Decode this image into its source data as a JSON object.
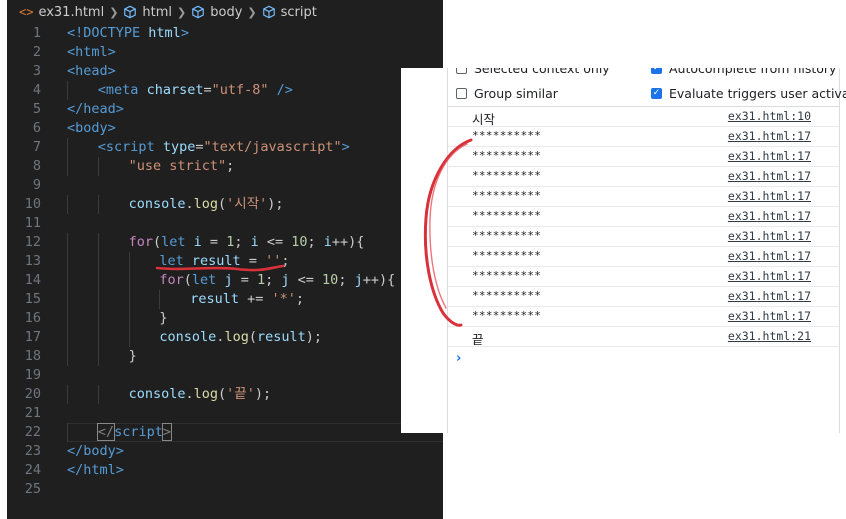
{
  "breadcrumb": {
    "file": "ex31.html",
    "crumbs": [
      "html",
      "body",
      "script"
    ]
  },
  "editor": {
    "lines": [
      {
        "n": "1",
        "indent": 0,
        "tokens": [
          [
            "tag",
            "<!DOCTYPE"
          ],
          [
            "txt",
            " "
          ],
          [
            "attr",
            "html"
          ],
          [
            "tag",
            ">"
          ]
        ]
      },
      {
        "n": "2",
        "indent": 0,
        "tokens": [
          [
            "tag",
            "<html>"
          ]
        ]
      },
      {
        "n": "3",
        "indent": 0,
        "tokens": [
          [
            "tag",
            "<head>"
          ]
        ]
      },
      {
        "n": "4",
        "indent": 1,
        "tokens": [
          [
            "tag",
            "<meta"
          ],
          [
            "txt",
            " "
          ],
          [
            "attr",
            "charset"
          ],
          [
            "txt",
            "="
          ],
          [
            "str",
            "\"utf-8\""
          ],
          [
            "txt",
            " "
          ],
          [
            "tag",
            "/>"
          ]
        ]
      },
      {
        "n": "5",
        "indent": 0,
        "tokens": [
          [
            "tag",
            "</head>"
          ]
        ]
      },
      {
        "n": "6",
        "indent": 0,
        "tokens": [
          [
            "tag",
            "<body>"
          ]
        ]
      },
      {
        "n": "7",
        "indent": 1,
        "tokens": [
          [
            "tag",
            "<script"
          ],
          [
            "txt",
            " "
          ],
          [
            "attr",
            "type"
          ],
          [
            "txt",
            "="
          ],
          [
            "str",
            "\"text/javascript\""
          ],
          [
            "tag",
            ">"
          ]
        ]
      },
      {
        "n": "8",
        "indent": 2,
        "tokens": [
          [
            "str",
            "\"use strict\""
          ],
          [
            "txt",
            ";"
          ]
        ]
      },
      {
        "n": "9",
        "indent": 0,
        "tokens": []
      },
      {
        "n": "10",
        "indent": 2,
        "tokens": [
          [
            "var",
            "console"
          ],
          [
            "txt",
            "."
          ],
          [
            "fn",
            "log"
          ],
          [
            "txt",
            "("
          ],
          [
            "str",
            "'시작'"
          ],
          [
            "txt",
            ");"
          ]
        ]
      },
      {
        "n": "11",
        "indent": 0,
        "tokens": []
      },
      {
        "n": "12",
        "indent": 2,
        "tokens": [
          [
            "ctl",
            "for"
          ],
          [
            "txt",
            "("
          ],
          [
            "kw",
            "let"
          ],
          [
            "txt",
            " "
          ],
          [
            "var",
            "i"
          ],
          [
            "txt",
            " = "
          ],
          [
            "num",
            "1"
          ],
          [
            "txt",
            "; "
          ],
          [
            "var",
            "i"
          ],
          [
            "txt",
            " <= "
          ],
          [
            "num",
            "10"
          ],
          [
            "txt",
            "; "
          ],
          [
            "var",
            "i"
          ],
          [
            "txt",
            "++){"
          ]
        ]
      },
      {
        "n": "13",
        "indent": 3,
        "tokens": [
          [
            "kw",
            "let"
          ],
          [
            "txt",
            " "
          ],
          [
            "var",
            "result"
          ],
          [
            "txt",
            " = "
          ],
          [
            "str",
            "''"
          ],
          [
            "txt",
            ";"
          ]
        ]
      },
      {
        "n": "14",
        "indent": 3,
        "tokens": [
          [
            "ctl",
            "for"
          ],
          [
            "txt",
            "("
          ],
          [
            "kw",
            "let"
          ],
          [
            "txt",
            " "
          ],
          [
            "var",
            "j"
          ],
          [
            "txt",
            " = "
          ],
          [
            "num",
            "1"
          ],
          [
            "txt",
            "; "
          ],
          [
            "var",
            "j"
          ],
          [
            "txt",
            " <= "
          ],
          [
            "num",
            "10"
          ],
          [
            "txt",
            "; "
          ],
          [
            "var",
            "j"
          ],
          [
            "txt",
            "++){"
          ]
        ]
      },
      {
        "n": "15",
        "indent": 4,
        "tokens": [
          [
            "var",
            "result"
          ],
          [
            "txt",
            " += "
          ],
          [
            "str",
            "'*'"
          ],
          [
            "txt",
            ";"
          ]
        ]
      },
      {
        "n": "16",
        "indent": 3,
        "tokens": [
          [
            "txt",
            "}"
          ]
        ]
      },
      {
        "n": "17",
        "indent": 3,
        "tokens": [
          [
            "var",
            "console"
          ],
          [
            "txt",
            "."
          ],
          [
            "fn",
            "log"
          ],
          [
            "txt",
            "("
          ],
          [
            "var",
            "result"
          ],
          [
            "txt",
            ");"
          ]
        ]
      },
      {
        "n": "18",
        "indent": 2,
        "tokens": [
          [
            "txt",
            "}"
          ]
        ]
      },
      {
        "n": "19",
        "indent": 0,
        "tokens": []
      },
      {
        "n": "20",
        "indent": 2,
        "tokens": [
          [
            "var",
            "console"
          ],
          [
            "txt",
            "."
          ],
          [
            "fn",
            "log"
          ],
          [
            "txt",
            "("
          ],
          [
            "str",
            "'끝'"
          ],
          [
            "txt",
            ");"
          ]
        ]
      },
      {
        "n": "21",
        "indent": 0,
        "tokens": []
      },
      {
        "n": "22",
        "indent": 1,
        "tokens": [
          [
            "pun",
            "</"
          ],
          [
            "tag",
            "script"
          ],
          [
            "pun",
            ">"
          ]
        ]
      },
      {
        "n": "23",
        "indent": 0,
        "tokens": [
          [
            "tag",
            "</body>"
          ]
        ]
      },
      {
        "n": "24",
        "indent": 0,
        "tokens": [
          [
            "tag",
            "</html>"
          ]
        ]
      },
      {
        "n": "25",
        "indent": 0,
        "tokens": []
      }
    ]
  },
  "console": {
    "settings": {
      "selected_context": "Selected context only",
      "autocomplete": "Autocomplete from history",
      "group_similar": "Group similar",
      "evaluate_triggers": "Evaluate triggers user activation"
    },
    "messages": [
      {
        "text": "시작",
        "source": "ex31.html:10"
      },
      {
        "text": "**********",
        "source": "ex31.html:17"
      },
      {
        "text": "**********",
        "source": "ex31.html:17"
      },
      {
        "text": "**********",
        "source": "ex31.html:17"
      },
      {
        "text": "**********",
        "source": "ex31.html:17"
      },
      {
        "text": "**********",
        "source": "ex31.html:17"
      },
      {
        "text": "**********",
        "source": "ex31.html:17"
      },
      {
        "text": "**********",
        "source": "ex31.html:17"
      },
      {
        "text": "**********",
        "source": "ex31.html:17"
      },
      {
        "text": "**********",
        "source": "ex31.html:17"
      },
      {
        "text": "**********",
        "source": "ex31.html:17"
      },
      {
        "text": "끝",
        "source": "ex31.html:21"
      }
    ],
    "prompt": "›"
  },
  "colors": {
    "editor_bg": "#1f1f1f",
    "annotation_red": "#d8313a",
    "console_accent": "#1a73e8"
  }
}
